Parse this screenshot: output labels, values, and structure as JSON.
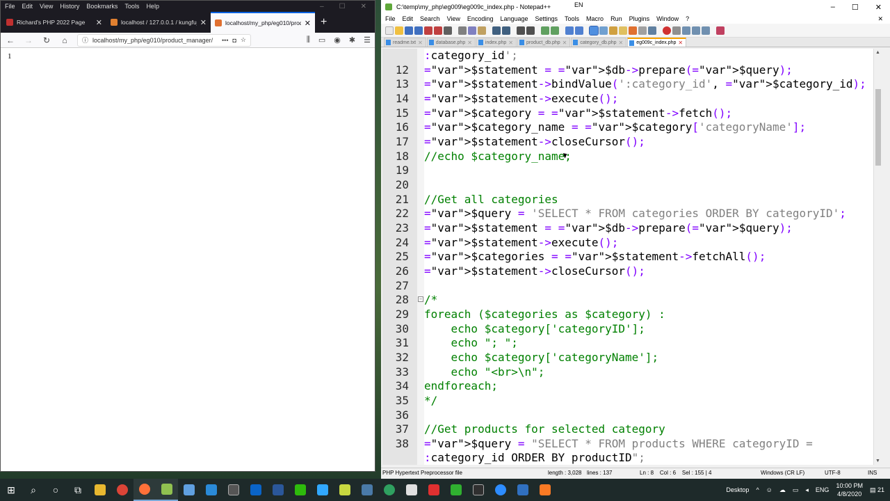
{
  "firefox": {
    "menu": [
      "File",
      "Edit",
      "View",
      "History",
      "Bookmarks",
      "Tools",
      "Help"
    ],
    "tabs": [
      {
        "title": "Richard's PHP 2022 Page",
        "icon_color": "#c03030"
      },
      {
        "title": "localhost / 127.0.0.1 / kungfu_",
        "icon_color": "#e08030"
      },
      {
        "title": "localhost/my_php/eg010/prod",
        "icon_color": "#e07030"
      }
    ],
    "url": "localhost/my_php/eg010/product_manager/",
    "page_text": "1"
  },
  "npp": {
    "title": "C:\\temp\\my_php\\eg009\\eg009c_index.php - Notepad++",
    "lang_indicator": "EN",
    "menu": [
      "File",
      "Edit",
      "Search",
      "View",
      "Encoding",
      "Language",
      "Settings",
      "Tools",
      "Macro",
      "Run",
      "Plugins",
      "Window",
      "?"
    ],
    "tabs": [
      {
        "name": "readme.txt",
        "active": false
      },
      {
        "name": "database.php",
        "active": false
      },
      {
        "name": "index.php",
        "active": false
      },
      {
        "name": "product_db.php",
        "active": false
      },
      {
        "name": "category_db.php",
        "active": false
      },
      {
        "name": "eg009c_index.php",
        "active": true
      }
    ],
    "code_lines": [
      {
        "n": "",
        "t": ":category_id';"
      },
      {
        "n": "12",
        "t": "$statement = $db->prepare($query);"
      },
      {
        "n": "13",
        "t": "$statement->bindValue(':category_id', $category_id);"
      },
      {
        "n": "14",
        "t": "$statement->execute();"
      },
      {
        "n": "15",
        "t": "$category = $statement->fetch();"
      },
      {
        "n": "16",
        "t": "$category_name = $category['categoryName'];"
      },
      {
        "n": "17",
        "t": "$statement->closeCursor();"
      },
      {
        "n": "18",
        "t": "//echo $category_name;"
      },
      {
        "n": "19",
        "t": ""
      },
      {
        "n": "20",
        "t": ""
      },
      {
        "n": "21",
        "t": "//Get all categories"
      },
      {
        "n": "22",
        "t": "$query = 'SELECT * FROM categories ORDER BY categoryID';"
      },
      {
        "n": "23",
        "t": "$statement = $db->prepare($query);"
      },
      {
        "n": "24",
        "t": "$statement->execute();"
      },
      {
        "n": "25",
        "t": "$categories = $statement->fetchAll();"
      },
      {
        "n": "26",
        "t": "$statement->closeCursor();"
      },
      {
        "n": "27",
        "t": ""
      },
      {
        "n": "28",
        "t": "/*"
      },
      {
        "n": "29",
        "t": "foreach ($categories as $category) :"
      },
      {
        "n": "30",
        "t": "    echo $category['categoryID'];"
      },
      {
        "n": "31",
        "t": "    echo \"; \";"
      },
      {
        "n": "32",
        "t": "    echo $category['categoryName'];"
      },
      {
        "n": "33",
        "t": "    echo \"<br>\\n\";"
      },
      {
        "n": "34",
        "t": "endforeach;"
      },
      {
        "n": "35",
        "t": "*/"
      },
      {
        "n": "36",
        "t": ""
      },
      {
        "n": "37",
        "t": "//Get products for selected category"
      },
      {
        "n": "38",
        "t": "$query = \"SELECT * FROM products WHERE categoryID ="
      },
      {
        "n": "",
        "t": ":category_id ORDER BY productID\";"
      }
    ],
    "status": {
      "lang": "PHP Hypertext Preprocessor file",
      "length": "length : 3,028",
      "lines": "lines : 137",
      "pos": "Ln : 8    Col : 6    Sel : 155 | 4",
      "eol": "Windows (CR LF)",
      "enc": "UTF-8",
      "mode": "INS"
    }
  },
  "taskbar": {
    "desktop_label": "Desktop",
    "lang": "ENG",
    "time": "10:00 PM",
    "date": "4/8/2020",
    "notif": "21"
  }
}
